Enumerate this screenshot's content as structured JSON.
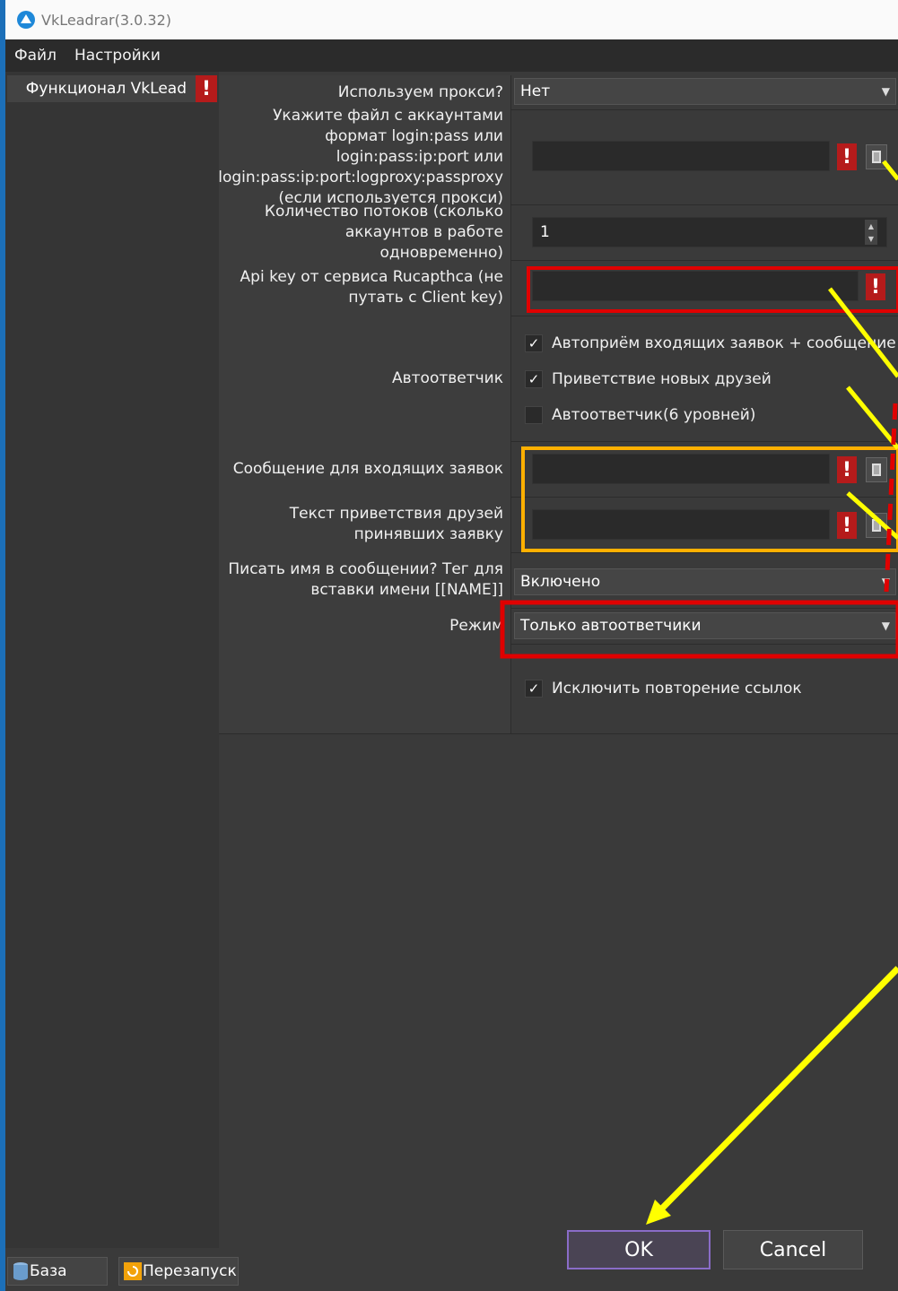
{
  "window": {
    "title": "VkLeadrar(3.0.32)"
  },
  "menu": {
    "file": "Файл",
    "settings": "Настройки"
  },
  "left": {
    "item_label": "Функционал VkLead",
    "item_badge": "!"
  },
  "form": {
    "proxy": {
      "label": "Используем прокси?",
      "value": "Нет"
    },
    "accounts_file": {
      "label": "Укажите файл с аккаунтами формат login:pass или login:pass:ip:port или login:pass:ip:port:logproxy:passproxy (если используется прокси)",
      "value": ""
    },
    "threads": {
      "label": "Количество потоков (сколько аккаунтов в работе одновременно)",
      "value": "1"
    },
    "api_key": {
      "label": "Api key от сервиса Rucapthca (не путать с Client key)",
      "value": ""
    },
    "autoresponder": {
      "label": "Автоответчик",
      "options": [
        {
          "label": "Автоприём входящих заявок + сообщение",
          "checked": true
        },
        {
          "label": "Приветствие новых друзей",
          "checked": true
        },
        {
          "label": "Автоответчик(6 уровней)",
          "checked": false
        }
      ]
    },
    "incoming_message": {
      "label": "Сообщение для входящих заявок",
      "value": ""
    },
    "greeting_text": {
      "label": "Текст приветствия друзей принявших заявку",
      "value": ""
    },
    "write_name": {
      "label": "Писать имя в сообщении? Тег для вставки имени [[NAME]]",
      "value": "Включено"
    },
    "mode": {
      "label": "Режим",
      "value": "Только автоответчики"
    },
    "exclude_links": {
      "label": "Исключить повторение ссылок",
      "checked": true
    }
  },
  "buttons": {
    "ok": "OK",
    "cancel": "Cancel"
  },
  "bottom": {
    "base": "База",
    "restart": "Перезапуск"
  },
  "icons": {
    "error": "exclamation-icon",
    "file": "folder-icon",
    "check": "✓"
  },
  "colors": {
    "error_red": "#b51b1b",
    "annotation_red": "#e00000",
    "annotation_yellow": "#ffff00",
    "annotation_orange": "#ffb000",
    "ok_border": "#8a6cc8"
  }
}
